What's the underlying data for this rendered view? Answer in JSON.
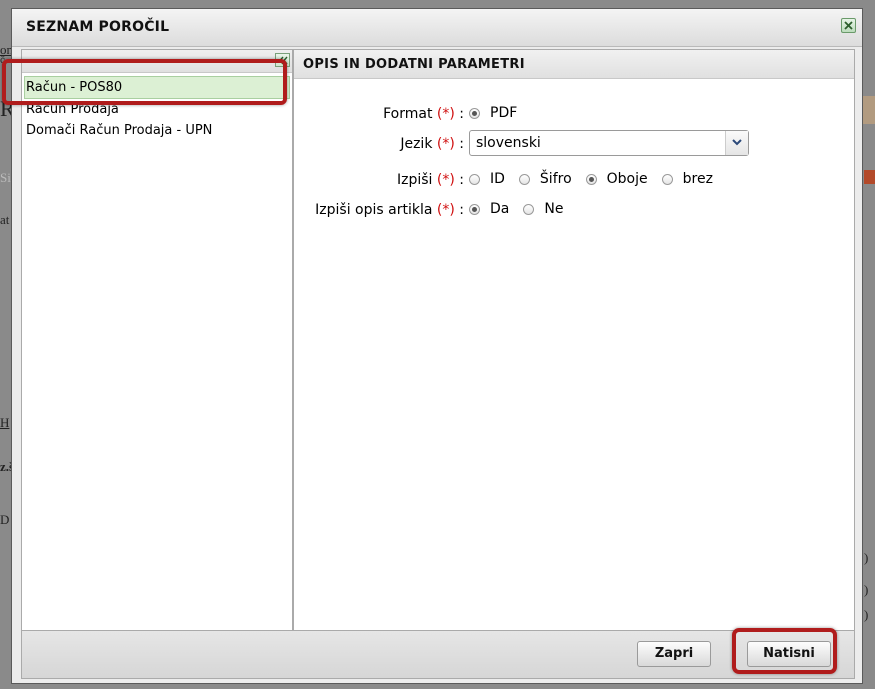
{
  "background": {
    "fragments": [
      "on",
      "č",
      "Ri",
      "Si",
      "at",
      "H",
      "z.š",
      "D",
      ")",
      ")",
      ")"
    ]
  },
  "dialog": {
    "title": "SEZNAM POROČIL",
    "close_icon": "close-icon",
    "collapse_icon": "collapse-left-icon"
  },
  "reports": {
    "items": [
      "Račun - POS80",
      "Račun Prodaja",
      "Domači Račun Prodaja - UPN"
    ],
    "selected_index": 0
  },
  "params": {
    "heading": "OPIS IN DODATNI PARAMETRI",
    "required_marker": "(*)",
    "separator": ":",
    "format": {
      "label": "Format",
      "options": [
        "PDF"
      ],
      "selected": "PDF"
    },
    "jezik": {
      "label": "Jezik",
      "value": "slovenski"
    },
    "izpisi": {
      "label": "Izpiši",
      "options": [
        "ID",
        "Šifro",
        "Oboje",
        "brez"
      ],
      "selected": "Oboje"
    },
    "izpisi_opis": {
      "label": "Izpiši opis artikla",
      "options": [
        "Da",
        "Ne"
      ],
      "selected": "Da"
    }
  },
  "footer": {
    "close_label": "Zapri",
    "print_label": "Natisni"
  },
  "colors": {
    "required": "#d01010",
    "highlight_ring": "#b01c1c",
    "selected_row": "#dcf0d4"
  }
}
